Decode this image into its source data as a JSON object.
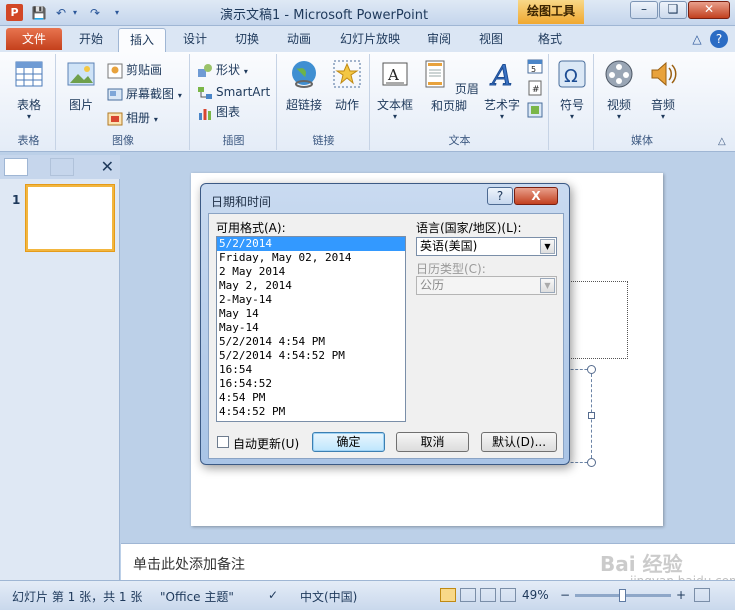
{
  "window": {
    "title": "演示文稿1 - Microsoft PowerPoint",
    "contextual_tab": "绘图工具",
    "help": "?"
  },
  "tabs": {
    "file": "文件",
    "items": [
      "开始",
      "插入",
      "设计",
      "切换",
      "动画",
      "幻灯片放映",
      "审阅",
      "视图",
      "格式"
    ],
    "active": "插入"
  },
  "ribbon": {
    "groups": {
      "table": {
        "label": "表格",
        "button": "表格"
      },
      "images": {
        "label": "图像",
        "picture": "图片",
        "clipart": "剪贴画",
        "screenshot": "屏幕截图",
        "album": "相册"
      },
      "illustrations": {
        "label": "插图",
        "shapes": "形状",
        "smartart": "SmartArt",
        "chart": "图表"
      },
      "links": {
        "label": "链接",
        "hyperlink": "超链接",
        "action": "动作"
      },
      "text": {
        "label": "文本",
        "textbox": "文本框",
        "header_footer": "页眉和页脚",
        "wordart": "艺术字"
      },
      "symbols": {
        "label": "",
        "symbol": "符号"
      },
      "media": {
        "label": "媒体",
        "video": "视频",
        "audio": "音频"
      }
    }
  },
  "slides_pane": {
    "slide_number": "1"
  },
  "notes": {
    "placeholder": "单击此处添加备注"
  },
  "status": {
    "slide_info": "幻灯片 第 1 张，共 1 张",
    "theme": "\"Office 主题\"",
    "language": "中文(中国)",
    "zoom": "49%",
    "zoom_level": 0.49
  },
  "dialog": {
    "title": "日期和时间",
    "help_btn": "?",
    "close_btn": "X",
    "formats_label": "可用格式(A):",
    "formats": [
      "5/2/2014",
      "Friday, May 02, 2014",
      "2 May 2014",
      "May 2, 2014",
      "2-May-14",
      "May 14",
      "May-14",
      "5/2/2014 4:54 PM",
      "5/2/2014 4:54:52 PM",
      "16:54",
      "16:54:52",
      "4:54 PM",
      "4:54:52 PM"
    ],
    "selected_index": 0,
    "language_label": "语言(国家/地区)(L):",
    "language_value": "英语(美国)",
    "calendar_label": "日历类型(C):",
    "calendar_value": "公历",
    "auto_update": "自动更新(U)",
    "ok": "确定",
    "cancel": "取消",
    "default": "默认(D)..."
  },
  "watermark": {
    "text": "Bai 经验",
    "url": "jingyan.baidu.com"
  },
  "colors": {
    "accent": "#2b579a",
    "file_tab": "#c4401c",
    "contextual": "#f0a830",
    "selection": "#3399ff"
  }
}
